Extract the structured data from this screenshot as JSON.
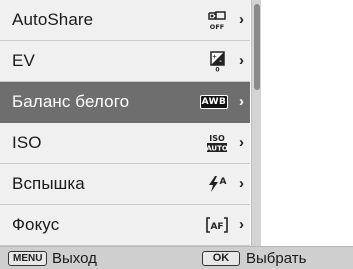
{
  "menu": {
    "items": [
      {
        "label": "AutoShare",
        "value_icon": "autoshare-off-icon",
        "value_text": "OFF",
        "selected": false
      },
      {
        "label": "EV",
        "value_icon": "exposure-value-icon",
        "value_text": "0",
        "selected": false
      },
      {
        "label": "Баланс белого",
        "value_icon": "white-balance-auto-icon",
        "value_text": "AWB",
        "selected": true
      },
      {
        "label": "ISO",
        "value_icon": "iso-auto-icon",
        "value_text": "ISO AUTO",
        "selected": false
      },
      {
        "label": "Вспышка",
        "value_icon": "flash-auto-icon",
        "value_text": "A",
        "selected": false
      },
      {
        "label": "Фокус",
        "value_icon": "autofocus-icon",
        "value_text": "AF",
        "selected": false
      }
    ]
  },
  "footer": {
    "menu_key": "MENU",
    "menu_action": "Выход",
    "ok_key": "OK",
    "ok_action": "Выбрать"
  },
  "colors": {
    "selected_bg": "#6e6e6e",
    "item_bg": "#f0f0f0",
    "footer_bg": "#cfcfcf"
  }
}
